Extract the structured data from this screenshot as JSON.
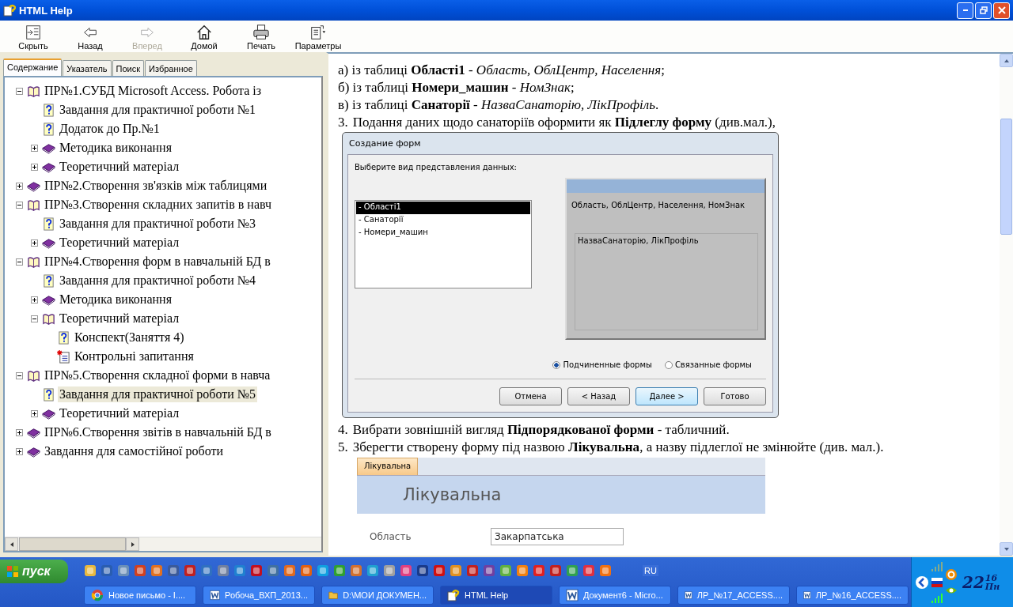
{
  "window": {
    "title": "HTML Help"
  },
  "toolbar": [
    {
      "label": "Скрыть",
      "kind": "hide",
      "disabled": false
    },
    {
      "label": "Назад",
      "kind": "back",
      "disabled": false
    },
    {
      "label": "Вперед",
      "kind": "forward",
      "disabled": true
    },
    {
      "label": "Домой",
      "kind": "home",
      "disabled": false
    },
    {
      "label": "Печать",
      "kind": "print",
      "disabled": false
    },
    {
      "label": "Параметры",
      "kind": "options",
      "disabled": false
    }
  ],
  "nav_tabs": [
    {
      "label": "Содержание",
      "selected": true
    },
    {
      "label": "Указатель",
      "selected": false
    },
    {
      "label": "Поиск",
      "selected": false
    },
    {
      "label": "Избранное",
      "selected": false
    }
  ],
  "tree": [
    {
      "label": "ПР№1.СУБД Microsoft Access. Робота із",
      "kind": "book",
      "expanded": true,
      "selected": false,
      "children": [
        {
          "label": "Завдання для практичної роботи №1",
          "kind": "topic",
          "selected": false
        },
        {
          "label": "Додаток до Пр.№1",
          "kind": "topic",
          "selected": false
        },
        {
          "label": "Методика виконання",
          "kind": "book",
          "expanded": false,
          "selected": false
        },
        {
          "label": "Теоретичний матеріал",
          "kind": "book",
          "expanded": false,
          "selected": false
        }
      ]
    },
    {
      "label": "ПР№2.Створення зв'язків між таблицями",
      "kind": "book",
      "expanded": false,
      "selected": false
    },
    {
      "label": "ПР№3.Створення складних запитів в навч",
      "kind": "book",
      "expanded": true,
      "selected": false,
      "children": [
        {
          "label": "Завдання для практичної роботи №3",
          "kind": "topic",
          "selected": false
        },
        {
          "label": "Теоретичний матеріал",
          "kind": "book",
          "expanded": false,
          "selected": false
        }
      ]
    },
    {
      "label": "ПР№4.Створення форм в навчальній БД в",
      "kind": "book",
      "expanded": true,
      "selected": false,
      "children": [
        {
          "label": "Завдання для практичної роботи №4",
          "kind": "topic",
          "selected": false
        },
        {
          "label": "Методика виконання",
          "kind": "book",
          "expanded": false,
          "selected": false
        },
        {
          "label": "Теоретичний матеріал",
          "kind": "book",
          "expanded": true,
          "selected": false,
          "children": [
            {
              "label": "Конспект(Заняття 4)",
              "kind": "topic",
              "selected": false
            },
            {
              "label": "Контрольні запитання",
              "kind": "new-topic",
              "selected": false
            }
          ]
        }
      ]
    },
    {
      "label": "ПР№5.Створення складної форми в навча",
      "kind": "book",
      "expanded": true,
      "selected": false,
      "children": [
        {
          "label": "Завдання для практичної роботи №5",
          "kind": "topic",
          "selected": true
        },
        {
          "label": "Теоретичний матеріал",
          "kind": "book",
          "expanded": false,
          "selected": false
        }
      ]
    },
    {
      "label": "ПР№6.Створення звітів в навчальній БД в",
      "kind": "book",
      "expanded": false,
      "selected": false
    },
    {
      "label": "Завдання для самостійної роботи",
      "kind": "book",
      "expanded": false,
      "selected": false
    }
  ],
  "content": {
    "lines": [
      "а) із таблиці **Області1** - *Область, ОблЦентр, Населення*;",
      "б) із таблиці **Номери_машин** - *НомЗнак*;",
      "в) із таблиці **Санаторії** - *НазваСанаторію, ЛікПрофіль*."
    ],
    "step_before": {
      "number": "3.",
      "text": "Подання даних щодо санаторіїв оформити як **Підлеглу форму** (див.мал.),"
    },
    "dialog": {
      "title": "Создание форм",
      "prompt": "Выберите вид представления данных:",
      "tables": [
        {
          "label": "- Області1",
          "selected": true
        },
        {
          "label": "- Санаторії",
          "selected": false
        },
        {
          "label": "- Номери_машин",
          "selected": false
        }
      ],
      "main_fields": "Область, ОблЦентр, Населення, НомЗнак",
      "sub_fields": "НазваСанаторію, ЛікПрофіль",
      "options": [
        {
          "label": "Подчиненные формы",
          "selected": true
        },
        {
          "label": "Связанные формы",
          "selected": false
        }
      ],
      "buttons": [
        {
          "label": "Отмена",
          "default": false
        },
        {
          "label": "< Назад",
          "default": false
        },
        {
          "label": "Далее >",
          "default": true
        },
        {
          "label": "Готово",
          "default": false
        }
      ]
    },
    "steps_after": [
      {
        "number": "4.",
        "text": "Вибрати зовнішній вигляд **Підпорядкованої форми** - табличний."
      },
      {
        "number": "5.",
        "text": "Зберегти створену форму під назвою **Лікувальна**, а назву підлеглої не змінюйте (див. мал.)."
      }
    ],
    "form_preview": {
      "tab": "Лікувальна",
      "heading": "Лікувальна",
      "fields": [
        {
          "label": "Область",
          "value": "Закарпатська"
        }
      ]
    }
  },
  "taskbar": {
    "start": "пуск",
    "language": "RU",
    "tasks": [
      {
        "label": "Новое письмо - I....",
        "kind": "browser",
        "selected": false
      },
      {
        "label": "Робоча_ВХП_2013...",
        "kind": "word",
        "selected": false
      },
      {
        "label": "D:\\МОИ ДОКУМЕН...",
        "kind": "folder",
        "selected": false
      },
      {
        "label": "HTML Help",
        "kind": "help",
        "selected": true
      },
      {
        "label": "Документ6 - Micro...",
        "kind": "word",
        "selected": false
      },
      {
        "label": "ЛР_№17_ACCESS....",
        "kind": "word",
        "selected": false
      },
      {
        "label": "ЛР_№16_ACCESS....",
        "kind": "word",
        "selected": false
      }
    ],
    "clock": {
      "hours": "22",
      "minutes": "16",
      "day": "Пн"
    }
  }
}
